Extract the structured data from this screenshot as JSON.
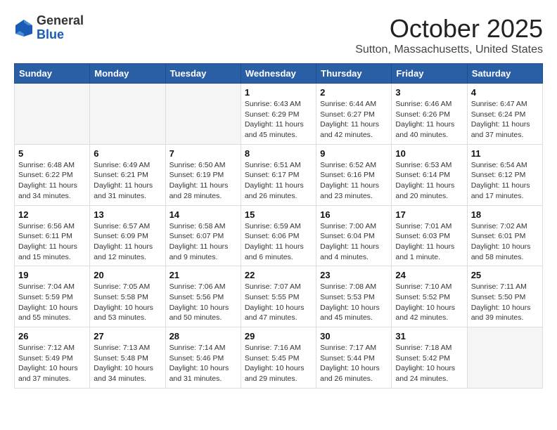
{
  "logo": {
    "general": "General",
    "blue": "Blue"
  },
  "title": "October 2025",
  "location": "Sutton, Massachusetts, United States",
  "days_header": [
    "Sunday",
    "Monday",
    "Tuesday",
    "Wednesday",
    "Thursday",
    "Friday",
    "Saturday"
  ],
  "weeks": [
    [
      {
        "day": "",
        "info": ""
      },
      {
        "day": "",
        "info": ""
      },
      {
        "day": "",
        "info": ""
      },
      {
        "day": "1",
        "info": "Sunrise: 6:43 AM\nSunset: 6:29 PM\nDaylight: 11 hours\nand 45 minutes."
      },
      {
        "day": "2",
        "info": "Sunrise: 6:44 AM\nSunset: 6:27 PM\nDaylight: 11 hours\nand 42 minutes."
      },
      {
        "day": "3",
        "info": "Sunrise: 6:46 AM\nSunset: 6:26 PM\nDaylight: 11 hours\nand 40 minutes."
      },
      {
        "day": "4",
        "info": "Sunrise: 6:47 AM\nSunset: 6:24 PM\nDaylight: 11 hours\nand 37 minutes."
      }
    ],
    [
      {
        "day": "5",
        "info": "Sunrise: 6:48 AM\nSunset: 6:22 PM\nDaylight: 11 hours\nand 34 minutes."
      },
      {
        "day": "6",
        "info": "Sunrise: 6:49 AM\nSunset: 6:21 PM\nDaylight: 11 hours\nand 31 minutes."
      },
      {
        "day": "7",
        "info": "Sunrise: 6:50 AM\nSunset: 6:19 PM\nDaylight: 11 hours\nand 28 minutes."
      },
      {
        "day": "8",
        "info": "Sunrise: 6:51 AM\nSunset: 6:17 PM\nDaylight: 11 hours\nand 26 minutes."
      },
      {
        "day": "9",
        "info": "Sunrise: 6:52 AM\nSunset: 6:16 PM\nDaylight: 11 hours\nand 23 minutes."
      },
      {
        "day": "10",
        "info": "Sunrise: 6:53 AM\nSunset: 6:14 PM\nDaylight: 11 hours\nand 20 minutes."
      },
      {
        "day": "11",
        "info": "Sunrise: 6:54 AM\nSunset: 6:12 PM\nDaylight: 11 hours\nand 17 minutes."
      }
    ],
    [
      {
        "day": "12",
        "info": "Sunrise: 6:56 AM\nSunset: 6:11 PM\nDaylight: 11 hours\nand 15 minutes."
      },
      {
        "day": "13",
        "info": "Sunrise: 6:57 AM\nSunset: 6:09 PM\nDaylight: 11 hours\nand 12 minutes."
      },
      {
        "day": "14",
        "info": "Sunrise: 6:58 AM\nSunset: 6:07 PM\nDaylight: 11 hours\nand 9 minutes."
      },
      {
        "day": "15",
        "info": "Sunrise: 6:59 AM\nSunset: 6:06 PM\nDaylight: 11 hours\nand 6 minutes."
      },
      {
        "day": "16",
        "info": "Sunrise: 7:00 AM\nSunset: 6:04 PM\nDaylight: 11 hours\nand 4 minutes."
      },
      {
        "day": "17",
        "info": "Sunrise: 7:01 AM\nSunset: 6:03 PM\nDaylight: 11 hours\nand 1 minute."
      },
      {
        "day": "18",
        "info": "Sunrise: 7:02 AM\nSunset: 6:01 PM\nDaylight: 10 hours\nand 58 minutes."
      }
    ],
    [
      {
        "day": "19",
        "info": "Sunrise: 7:04 AM\nSunset: 5:59 PM\nDaylight: 10 hours\nand 55 minutes."
      },
      {
        "day": "20",
        "info": "Sunrise: 7:05 AM\nSunset: 5:58 PM\nDaylight: 10 hours\nand 53 minutes."
      },
      {
        "day": "21",
        "info": "Sunrise: 7:06 AM\nSunset: 5:56 PM\nDaylight: 10 hours\nand 50 minutes."
      },
      {
        "day": "22",
        "info": "Sunrise: 7:07 AM\nSunset: 5:55 PM\nDaylight: 10 hours\nand 47 minutes."
      },
      {
        "day": "23",
        "info": "Sunrise: 7:08 AM\nSunset: 5:53 PM\nDaylight: 10 hours\nand 45 minutes."
      },
      {
        "day": "24",
        "info": "Sunrise: 7:10 AM\nSunset: 5:52 PM\nDaylight: 10 hours\nand 42 minutes."
      },
      {
        "day": "25",
        "info": "Sunrise: 7:11 AM\nSunset: 5:50 PM\nDaylight: 10 hours\nand 39 minutes."
      }
    ],
    [
      {
        "day": "26",
        "info": "Sunrise: 7:12 AM\nSunset: 5:49 PM\nDaylight: 10 hours\nand 37 minutes."
      },
      {
        "day": "27",
        "info": "Sunrise: 7:13 AM\nSunset: 5:48 PM\nDaylight: 10 hours\nand 34 minutes."
      },
      {
        "day": "28",
        "info": "Sunrise: 7:14 AM\nSunset: 5:46 PM\nDaylight: 10 hours\nand 31 minutes."
      },
      {
        "day": "29",
        "info": "Sunrise: 7:16 AM\nSunset: 5:45 PM\nDaylight: 10 hours\nand 29 minutes."
      },
      {
        "day": "30",
        "info": "Sunrise: 7:17 AM\nSunset: 5:44 PM\nDaylight: 10 hours\nand 26 minutes."
      },
      {
        "day": "31",
        "info": "Sunrise: 7:18 AM\nSunset: 5:42 PM\nDaylight: 10 hours\nand 24 minutes."
      },
      {
        "day": "",
        "info": ""
      }
    ]
  ]
}
